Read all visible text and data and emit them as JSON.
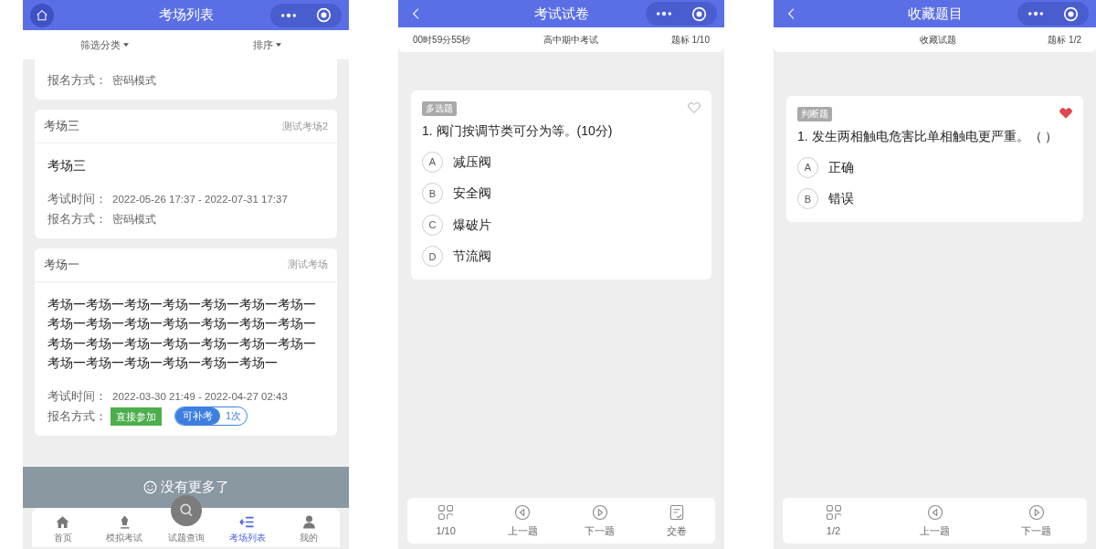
{
  "exam_list": {
    "header": {
      "title": "考场列表"
    },
    "filters": [
      {
        "label": "筛选分类"
      },
      {
        "label": "排序"
      }
    ],
    "cards": [
      {
        "rows": [
          {
            "kind": "text",
            "label": "报名方式：",
            "value": "密码模式"
          }
        ]
      },
      {
        "name": "考场三",
        "tag": "测试考场2",
        "title": "考场三",
        "rows": [
          {
            "kind": "text",
            "label": "考试时间：",
            "value": "2022-05-26 17:37 - 2022-07-31 17:37"
          },
          {
            "kind": "text",
            "label": "报名方式：",
            "value": "密码模式"
          }
        ]
      },
      {
        "name": "考场一",
        "tag": "测试考场",
        "title": "考场一考场一考场一考场一考场一考场一考场一考场一考场一考场一考场一考场一考场一考场一考场一考场一考场一考场一考场一考场一考场一考场一考场一考场一考场一考场一考场一",
        "rows": [
          {
            "kind": "text",
            "label": "考试时间：",
            "value": "2022-03-30 21:49 - 2022-04-27 02:43"
          },
          {
            "kind": "badges",
            "label": "报名方式：",
            "badges": [
              {
                "kind": "green",
                "text": "直接参加"
              },
              {
                "kind": "pill",
                "text": "可补考",
                "count": "1次"
              }
            ]
          }
        ]
      }
    ],
    "end_note": "没有更多了",
    "tabs": [
      {
        "label": "首页",
        "kind": "plain",
        "selected": false
      },
      {
        "label": "模拟考试",
        "kind": "plain",
        "selected": false
      },
      {
        "label": "试题查询",
        "kind": "raised",
        "selected": false
      },
      {
        "label": "考场列表",
        "kind": "plain",
        "selected": true
      },
      {
        "label": "我的",
        "kind": "plain",
        "selected": false
      }
    ]
  },
  "exam_paper": {
    "header": {
      "title": "考试试卷"
    },
    "info": [
      "00时59分55秒",
      "高中期中考试",
      "题标 1/10"
    ],
    "question": {
      "type": "多选题",
      "text": "1. 阀门按调节类可分为等。(10分)",
      "favorited": false,
      "options": [
        {
          "letter": "A",
          "text": "减压阀"
        },
        {
          "letter": "B",
          "text": "安全阀"
        },
        {
          "letter": "C",
          "text": "爆破片"
        },
        {
          "letter": "D",
          "text": "节流阀"
        }
      ]
    },
    "actions": [
      {
        "label": "1/10"
      },
      {
        "label": "上一题"
      },
      {
        "label": "下一题"
      },
      {
        "label": "交卷"
      }
    ]
  },
  "favorites": {
    "header": {
      "title": "收藏题目"
    },
    "info": [
      "收藏试题",
      "题标 1/2"
    ],
    "question": {
      "type": "判断题",
      "text": "1. 发生两相触电危害比单相触电更严重。（ ）",
      "favorited": true,
      "options": [
        {
          "letter": "A",
          "text": "正确"
        },
        {
          "letter": "B",
          "text": "错误"
        }
      ]
    },
    "actions": [
      {
        "label": "1/2"
      },
      {
        "label": "上一题"
      },
      {
        "label": "下一题"
      }
    ]
  }
}
